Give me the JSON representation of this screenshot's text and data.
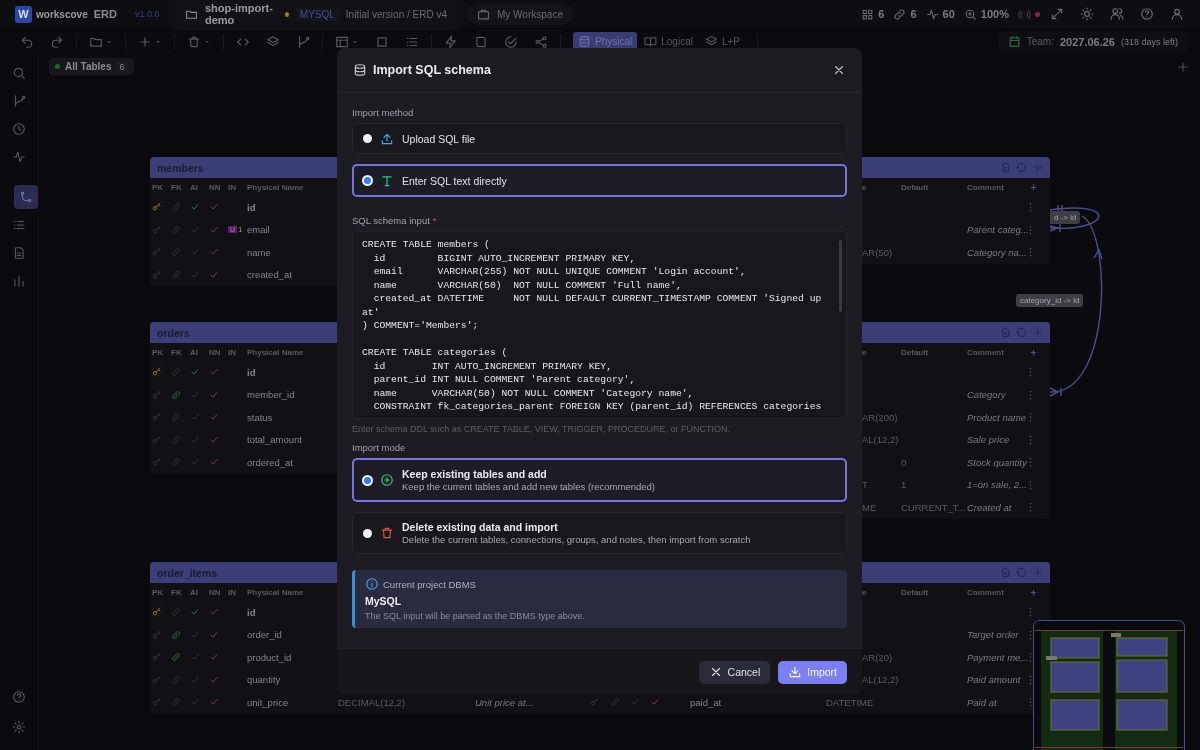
{
  "app": {
    "logo_letter": "W",
    "brand": "workscove",
    "product": "ERD",
    "version": "v1.0.0"
  },
  "project": {
    "name": "shop-import-demo",
    "unsaved": true,
    "dbms": "MYSQL",
    "version": "Initial version / ERD v4",
    "workspace": "My Workspace"
  },
  "stats": {
    "tables": "6",
    "relations": "6",
    "fps": "60",
    "zoom": "100%",
    "live": false
  },
  "view_tabs": [
    {
      "kind": "physical",
      "label": "Physical",
      "selected": true
    },
    {
      "kind": "logical",
      "label": "Logical",
      "selected": false
    },
    {
      "kind": "both",
      "label": "L+P",
      "selected": false
    }
  ],
  "license": {
    "label": "Team:",
    "date": "2027.06.26",
    "remaining": "(318 days left)"
  },
  "sidebar_items": [
    {
      "kind": "search",
      "selected": false
    },
    {
      "kind": "branch",
      "selected": false
    },
    {
      "kind": "history",
      "selected": false
    },
    {
      "kind": "activity",
      "selected": false
    },
    {
      "kind": "diagram",
      "selected": true
    },
    {
      "kind": "list",
      "selected": false
    },
    {
      "kind": "document",
      "selected": false
    },
    {
      "kind": "chart",
      "selected": false
    }
  ],
  "canvas_tabs": [
    {
      "label": "All Tables",
      "count": "6",
      "selected": true
    }
  ],
  "left_tables": [
    {
      "name": "members",
      "columns": [
        "PK",
        "FK",
        "AI",
        "NN",
        "IN",
        "Physical Name"
      ],
      "rows": [
        {
          "pk": true,
          "fk": false,
          "ai": true,
          "nn": true,
          "name": "id"
        },
        {
          "pk": false,
          "fk": false,
          "ai": false,
          "nn": true,
          "index": "U",
          "index_count": "1",
          "name": "email"
        },
        {
          "pk": false,
          "fk": false,
          "ai": false,
          "nn": true,
          "name": "name"
        },
        {
          "pk": false,
          "fk": false,
          "ai": false,
          "nn": true,
          "name": "created_at"
        }
      ]
    },
    {
      "name": "orders",
      "columns": [
        "PK",
        "FK",
        "AI",
        "NN",
        "IN",
        "Physical Name"
      ],
      "rows": [
        {
          "pk": true,
          "fk": false,
          "ai": true,
          "nn": true,
          "name": "id"
        },
        {
          "pk": false,
          "fk": true,
          "ai": false,
          "nn": true,
          "name": "member_id"
        },
        {
          "pk": false,
          "fk": false,
          "ai": false,
          "nn": true,
          "name": "status"
        },
        {
          "pk": false,
          "fk": false,
          "ai": false,
          "nn": true,
          "name": "total_amount"
        },
        {
          "pk": false,
          "fk": false,
          "ai": false,
          "nn": true,
          "name": "ordered_at"
        }
      ]
    },
    {
      "name": "order_items",
      "columns": [
        "PK",
        "FK",
        "AI",
        "NN",
        "IN",
        "Physical Name"
      ],
      "rows": [
        {
          "pk": true,
          "fk": false,
          "ai": true,
          "nn": true,
          "name": "id"
        },
        {
          "pk": false,
          "fk": true,
          "ai": false,
          "nn": true,
          "name": "order_id"
        },
        {
          "pk": false,
          "fk": true,
          "ai": false,
          "nn": true,
          "name": "product_id"
        },
        {
          "pk": false,
          "fk": false,
          "ai": false,
          "nn": true,
          "name": "quantity"
        },
        {
          "pk": false,
          "fk": false,
          "ai": false,
          "nn": true,
          "name": "unit_price",
          "type": "DECIMAL(12,2)",
          "comment": "Unit price at..."
        }
      ]
    }
  ],
  "right_tables": [
    {
      "columns": [
        "e",
        "Default",
        "Comment"
      ],
      "rows": [
        {},
        {
          "comment": "Parent categ..."
        },
        {
          "type": "AR(50)",
          "comment": "Category na..."
        }
      ]
    },
    {
      "columns": [
        "e",
        "Default",
        "Comment"
      ],
      "rows": [
        {},
        {
          "comment": "Category"
        },
        {
          "type": "AR(200)",
          "comment": "Product name"
        },
        {
          "type": "AL(12,2)",
          "comment": "Sale price"
        },
        {
          "default": "0",
          "comment": "Stock quantity"
        },
        {
          "type": "T",
          "default": "1",
          "comment": "1=on sale, 2..."
        },
        {
          "type": "ME",
          "default": "CURRENT_T...",
          "comment": "Created at"
        }
      ]
    },
    {
      "columns": [
        "e",
        "Default",
        "Comment"
      ],
      "rows": [
        {},
        {
          "comment": "Target order"
        },
        {
          "type": "AR(20)",
          "comment": "Payment me..."
        },
        {
          "type": "AL(12,2)",
          "comment": "Paid amount"
        },
        {
          "pk": false,
          "fk": false,
          "ai": false,
          "nn": true,
          "name": "paid_at",
          "type": "DATETIME",
          "comment": "Paid at"
        }
      ]
    }
  ],
  "relation_labels": [
    "d -> id",
    "category_id -> id"
  ],
  "dialog": {
    "title": "Import SQL schema",
    "method_label": "Import method",
    "methods": [
      {
        "kind": "upload",
        "label": "Upload SQL file",
        "selected": false
      },
      {
        "kind": "text",
        "label": "Enter SQL text directly",
        "selected": true
      }
    ],
    "input_label": "SQL schema input",
    "required_mark": "*",
    "sql": "CREATE TABLE members (\n  id         BIGINT AUTO_INCREMENT PRIMARY KEY,\n  email      VARCHAR(255) NOT NULL UNIQUE COMMENT 'Login account',\n  name       VARCHAR(50)  NOT NULL COMMENT 'Full name',\n  created_at DATETIME     NOT NULL DEFAULT CURRENT_TIMESTAMP COMMENT 'Signed up at'\n) COMMENT='Members';\n\nCREATE TABLE categories (\n  id        INT AUTO_INCREMENT PRIMARY KEY,\n  parent_id INT NULL COMMENT 'Parent category',\n  name      VARCHAR(50) NOT NULL COMMENT 'Category name',\n  CONSTRAINT fk_categories_parent FOREIGN KEY (parent_id) REFERENCES categories",
    "hint": "Enter schema DDL such as CREATE TABLE, VIEW, TRIGGER, PROCEDURE, or FUNCTION.",
    "mode_label": "Import mode",
    "modes": [
      {
        "kind": "keep",
        "title": "Keep existing tables and add",
        "description": "Keep the current tables and add new tables (recommended)",
        "selected": true
      },
      {
        "kind": "replace",
        "title": "Delete existing data and import",
        "description": "Delete the current tables, connections, groups, and notes, then import from scratch",
        "selected": false
      }
    ],
    "dbms_info": {
      "title": "Current project DBMS",
      "value": "MySQL",
      "note": "The SQL input will be parsed as the DBMS type above."
    },
    "buttons": [
      {
        "kind": "cancel",
        "label": "Cancel"
      },
      {
        "kind": "import",
        "label": "Import"
      }
    ]
  }
}
